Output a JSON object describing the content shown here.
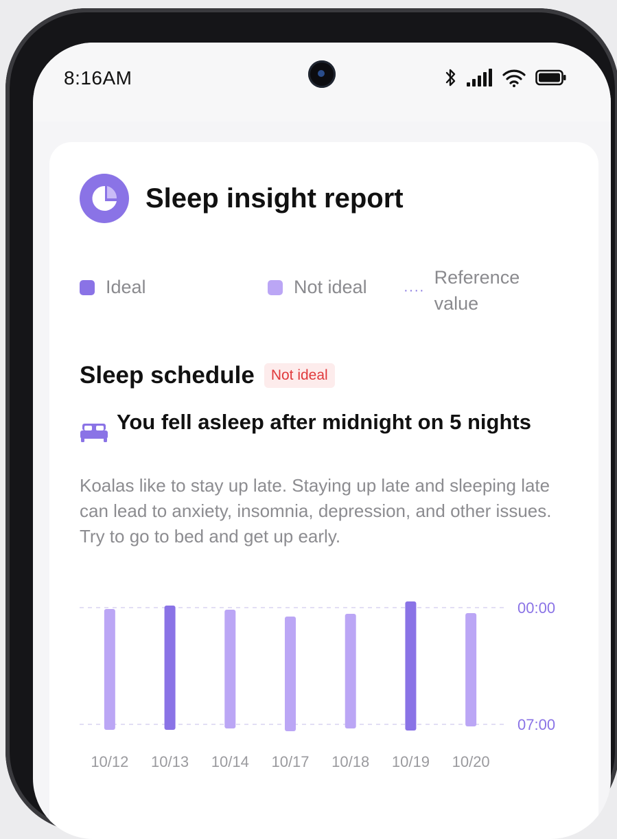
{
  "status_bar": {
    "time": "8:16AM"
  },
  "card": {
    "title": "Sleep insight report",
    "legend": {
      "ideal": "Ideal",
      "not_ideal": "Not ideal",
      "reference": "Reference value"
    },
    "section": {
      "title": "Sleep schedule",
      "badge": "Not ideal",
      "headline": "You fell asleep after midnight on 5 nights",
      "description": "Koalas like to stay up late. Staying up late and sleeping late can lead to anxiety, insomnia, depression, and other issues. Try to go to bed and get up early."
    }
  },
  "colors": {
    "ideal": "#8a73e6",
    "not_ideal": "#bba6f5",
    "badge_bg": "#fdecec",
    "badge_text": "#e0393b",
    "icon": "#8a73e6"
  },
  "icons": {
    "title": "report-icon",
    "headline": "bed-icon",
    "status": [
      "bluetooth-icon",
      "signal-icon",
      "wifi-icon",
      "battery-icon"
    ]
  },
  "chart_data": {
    "type": "bar",
    "categories": [
      "10/12",
      "10/13",
      "10/14",
      "10/17",
      "10/18",
      "10/19",
      "10/20"
    ],
    "series": [
      {
        "start": [
          "00:00",
          "00:00",
          "00:00",
          "00:00",
          "00:00",
          "00:00",
          "00:00"
        ],
        "end": [
          "07:00",
          "07:00",
          "07:00",
          "07:00",
          "07:00",
          "07:00",
          "07:00"
        ],
        "status": [
          "not ideal",
          "ideal",
          "not ideal",
          "not ideal",
          "not ideal",
          "ideal",
          "not ideal"
        ]
      }
    ],
    "reference_lines": [
      "00:00",
      "07:00"
    ],
    "ylim": [
      "00:00",
      "07:00"
    ]
  }
}
